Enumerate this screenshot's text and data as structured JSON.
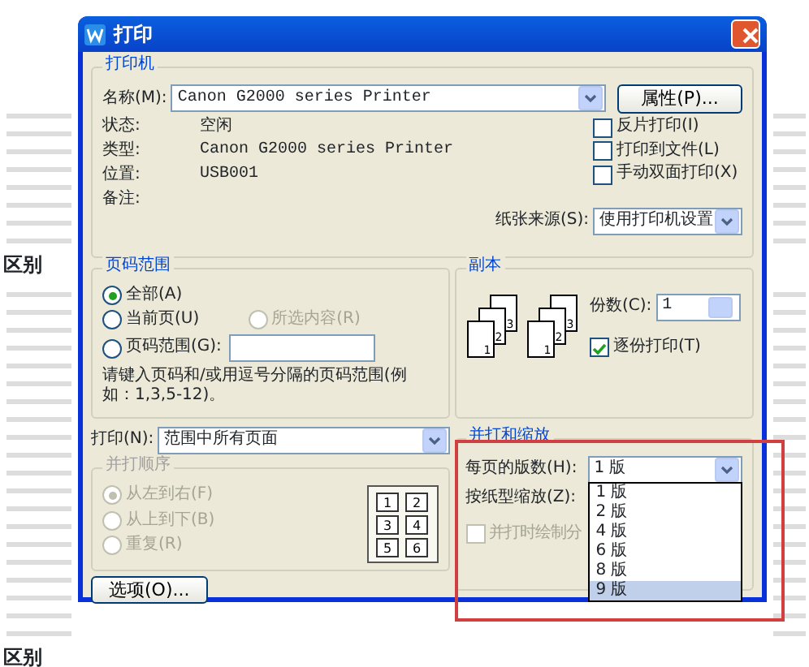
{
  "background": {
    "headings": [
      "区别",
      "区别"
    ]
  },
  "dialog": {
    "title": "打印",
    "printer": {
      "legend": "打印机",
      "name_label": "名称(M):",
      "name_value": "Canon G2000 series Printer",
      "properties_button": "属性(P)...",
      "info": [
        {
          "label": "状态:",
          "value": "空闲"
        },
        {
          "label": "类型:",
          "value": "Canon G2000 series Printer"
        },
        {
          "label": "位置:",
          "value": "USB001"
        },
        {
          "label": "备注:"
        }
      ],
      "options": [
        {
          "label": "反片打印(I)",
          "checked": false
        },
        {
          "label": "打印到文件(L)",
          "checked": false
        },
        {
          "label": "手动双面打印(X)",
          "checked": false
        }
      ],
      "paper_source_label": "纸张来源(S):",
      "paper_source_value": "使用打印机设置"
    },
    "page_range": {
      "legend": "页码范围",
      "choices": [
        {
          "label": "全部(A)",
          "selected": true,
          "disabled": false
        },
        {
          "label": "当前页(U)",
          "selected": false,
          "disabled": false
        },
        {
          "label": "所选内容(R)",
          "selected": false,
          "disabled": true
        },
        {
          "label": "页码范围(G):",
          "selected": false,
          "disabled": false
        }
      ],
      "hint": "请键入页码和/或用逗号分隔的页码范围(例如：1,3,5-12)。"
    },
    "print_what": {
      "label": "打印(N):",
      "value": "范围中所有页面"
    },
    "order": {
      "legend": "并打顺序",
      "disabled": true,
      "choices": [
        {
          "label": "从左到右(F)",
          "selected": true
        },
        {
          "label": "从上到下(B)",
          "selected": false
        },
        {
          "label": "重复(R)",
          "selected": false
        }
      ],
      "pages": [
        "1",
        "2",
        "3",
        "4",
        "5",
        "6"
      ]
    },
    "options_button": "选项(O)...",
    "copies": {
      "legend": "副本",
      "label": "份数(C):",
      "value": "1",
      "stacks": [
        [
          "1",
          "2",
          "3"
        ],
        [
          "1",
          "2",
          "3"
        ]
      ],
      "collate": {
        "label": "逐份打印(T)",
        "checked": true
      }
    },
    "zoom": {
      "legend": "并打和缩放",
      "per_page_label": "每页的版数(H):",
      "per_page_value": "1 版",
      "scale_label": "按纸型缩放(Z):",
      "draw_borders": {
        "label": "并打时绘制分",
        "checked": false,
        "disabled": true
      },
      "dropdown": [
        {
          "label": "1 版",
          "selected": false
        },
        {
          "label": "2 版",
          "selected": false
        },
        {
          "label": "4 版",
          "selected": false
        },
        {
          "label": "6 版",
          "selected": false
        },
        {
          "label": "8 版",
          "selected": false
        },
        {
          "label": "9 版",
          "selected": true
        }
      ]
    }
  },
  "highlight_frame": true
}
